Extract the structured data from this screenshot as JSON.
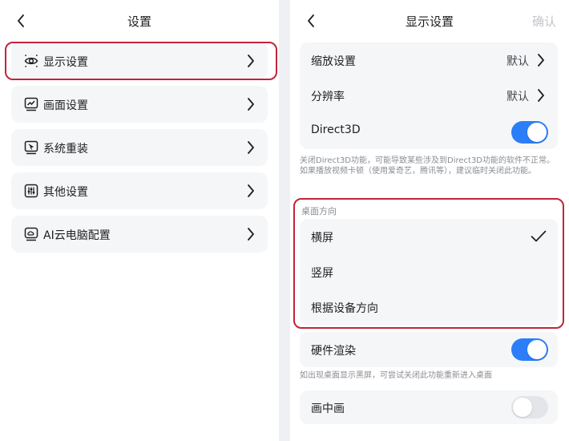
{
  "left": {
    "header": {
      "title": "设置"
    },
    "menu": [
      {
        "label": "显示设置",
        "icon": "eye-icon"
      },
      {
        "label": "画面设置",
        "icon": "chart-icon"
      },
      {
        "label": "系统重装",
        "icon": "system-reinstall-icon"
      },
      {
        "label": "其他设置",
        "icon": "sliders-icon"
      },
      {
        "label": "AI云电脑配置",
        "icon": "cloud-pc-icon"
      }
    ]
  },
  "right": {
    "header": {
      "title": "显示设置",
      "confirm": "确认"
    },
    "rows": {
      "zoom": {
        "label": "缩放设置",
        "value": "默认"
      },
      "resolution": {
        "label": "分辨率",
        "value": "默认"
      },
      "direct3d": {
        "label": "Direct3D",
        "on": true
      }
    },
    "direct3d_note": "关闭Direct3D功能，可能导致某些涉及到Direct3D功能的软件不正常。如果播放视频卡顿（使用爱奇艺，腾讯等），建议临时关闭此功能。",
    "orientation": {
      "section_label": "桌面方向",
      "options": [
        "横屏",
        "竖屏",
        "根据设备方向"
      ],
      "selected": "横屏"
    },
    "hardware_render": {
      "label": "硬件渲染",
      "on": true,
      "note": "如出现桌面显示黑屏，可尝试关闭此功能重新进入桌面"
    },
    "pip": {
      "label": "画中画",
      "on": false
    }
  },
  "colors": {
    "accent": "#2c7ef8",
    "highlight": "#c2243b",
    "card": "#f5f6f8"
  }
}
